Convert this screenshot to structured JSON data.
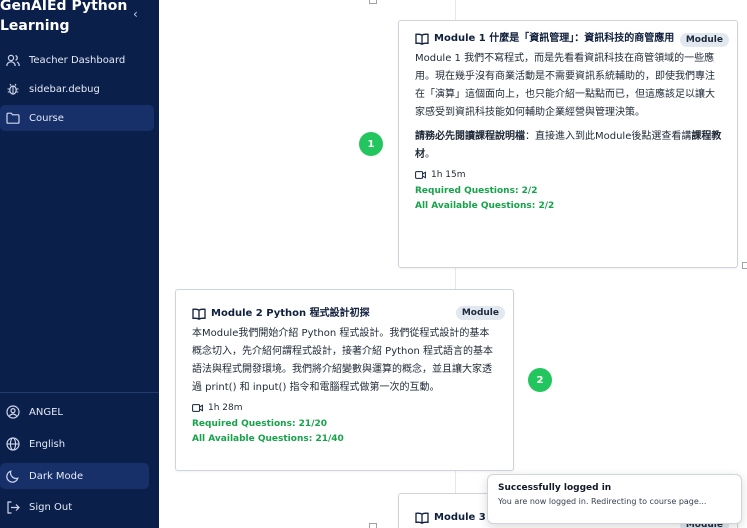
{
  "sidebar": {
    "brand": "GenAIEd Python Learning",
    "nav": [
      {
        "label": "Teacher Dashboard",
        "icon": "users-icon"
      },
      {
        "label": "sidebar.debug",
        "icon": "bug-icon"
      },
      {
        "label": "Course",
        "icon": "folder-icon"
      }
    ],
    "bottom": [
      {
        "label": "ANGEL",
        "icon": "user-circle-icon"
      },
      {
        "label": "English",
        "icon": "globe-icon"
      },
      {
        "label": "Dark Mode",
        "icon": "moon-icon"
      },
      {
        "label": "Sign Out",
        "icon": "sign-out-icon"
      }
    ]
  },
  "modules": [
    {
      "number": "1",
      "title": "Module 1 什麼是「資訊管理」：資訊科技的商管應用",
      "badge": "Module",
      "description": "Module 1 我們不寫程式，而是先看看資訊科技在商管領域的一些應用。現在幾乎沒有商業活動是不需要資訊系統輔助的，即使我們專注在「演算」這個面向上，也只能介紹一點點而已，但這應該足以讓大家感受到資訊科技能如何輔助企業經營與管理決策。",
      "note_bold_1": "請務必先閱讀課程說明檔",
      "note_mid": "：直接進入到此Module後點選查看講",
      "note_bold_2": "課程教材",
      "note_end": "。",
      "duration": "1h 15m",
      "required": "Required Questions: 2/2",
      "available": "All Available Questions: 2/2"
    },
    {
      "number": "2",
      "title": "Module 2 Python 程式設計初探",
      "badge": "Module",
      "description": "本Module我們開始介紹 Python 程式設計。我們從程式設計的基本概念切入，先介紹何謂程式設計，接著介紹 Python 程式語言的基本語法與程式開發環境。我們將介紹變數與運算的概念，並且讓大家透過 print() 和 input() 指令和電腦程式做第一次的互動。",
      "duration": "1h 28m",
      "required": "Required Questions: 21/20",
      "available": "All Available Questions: 21/40"
    },
    {
      "title": "Module 3",
      "badge": "Module"
    }
  ],
  "toast": {
    "title": "Successfully logged in",
    "message": "You are now logged in. Redirecting to course page..."
  }
}
